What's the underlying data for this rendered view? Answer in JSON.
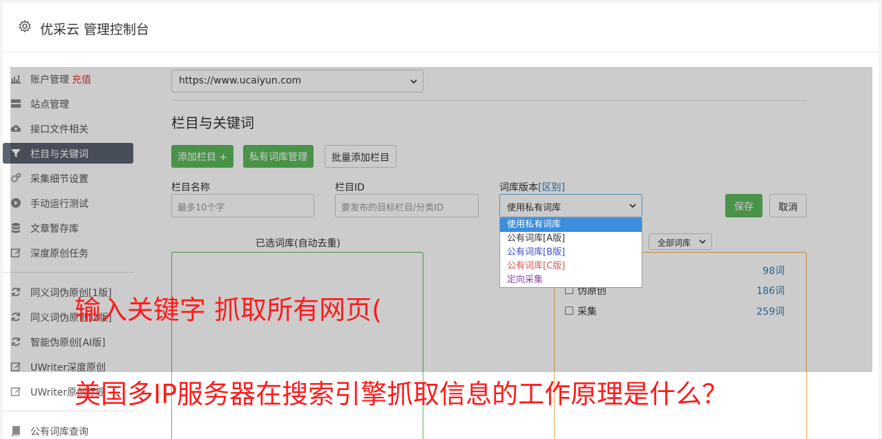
{
  "header": {
    "title": "优采云 管理控制台",
    "icon": "gear-icon"
  },
  "sidebar": {
    "items": [
      {
        "label": "账户管理",
        "badge": "充值",
        "icon": "bar-chart-icon"
      },
      {
        "label": "站点管理",
        "icon": "server-icon"
      },
      {
        "label": "接口文件相关",
        "icon": "cloud-upload-icon"
      },
      {
        "label": "栏目与关键词",
        "icon": "filter-icon",
        "active": true
      },
      {
        "label": "采集细节设置",
        "icon": "cogs-icon"
      },
      {
        "label": "手动运行测试",
        "icon": "play-circle-icon"
      },
      {
        "label": "文章暂存库",
        "icon": "database-icon"
      },
      {
        "label": "深度原创任务",
        "icon": "edit-icon"
      },
      {
        "label": "同义词伪原创[1版]",
        "icon": "refresh-icon"
      },
      {
        "label": "同义词伪原创[2版]",
        "icon": "refresh-icon"
      },
      {
        "label": "智能伪原创[AI版]",
        "icon": "refresh-icon"
      },
      {
        "label": "UWriter深度原创",
        "icon": "edit-icon"
      },
      {
        "label": "UWriter原创标题",
        "icon": "edit-icon"
      },
      {
        "label": "公有词库查询",
        "icon": "book-icon"
      }
    ]
  },
  "main": {
    "site_select": "https://www.ucaiyun.com",
    "section_title": "栏目与关键词",
    "buttons": {
      "add_column": "添加栏目 +",
      "private_lib": "私有词库管理",
      "batch_add": "批量添加栏目",
      "save": "保存",
      "cancel": "取消"
    },
    "form": {
      "column_name_label": "栏目名称",
      "column_name_placeholder": "最多10个字",
      "column_id_label": "栏目ID",
      "column_id_placeholder": "要发布的目标栏目/分类ID",
      "lib_version_label": "词库版本",
      "lib_version_link": "[区别]",
      "lib_version_value": "使用私有词库",
      "lib_options": [
        "使用私有词库",
        "公有词库[A版]",
        "公有词库[B版]",
        "公有词库[C版]",
        "定向采集"
      ]
    },
    "selected_lib_label": "已选词库(自动去重)",
    "filter_value": "全部词库",
    "libraries": [
      {
        "name": "",
        "count": "98词"
      },
      {
        "name": "伪原创",
        "count": "186词"
      },
      {
        "name": "采集",
        "count": "259词"
      }
    ]
  },
  "captions": [
    "输入关键字 抓取所有网页(",
    "美国多IP服务器在搜索引擎抓取信息的工作原理是什么？"
  ],
  "colors": {
    "green": "#5cb85c",
    "orange": "#f0ad4e",
    "caption_red": "#ff1a1a",
    "active_sidebar": "#5b6270",
    "option_selected": "#3b8ddd",
    "option_b": "#3c4bd1",
    "option_c": "#d9534f",
    "option_directed": "#8e44ad"
  }
}
